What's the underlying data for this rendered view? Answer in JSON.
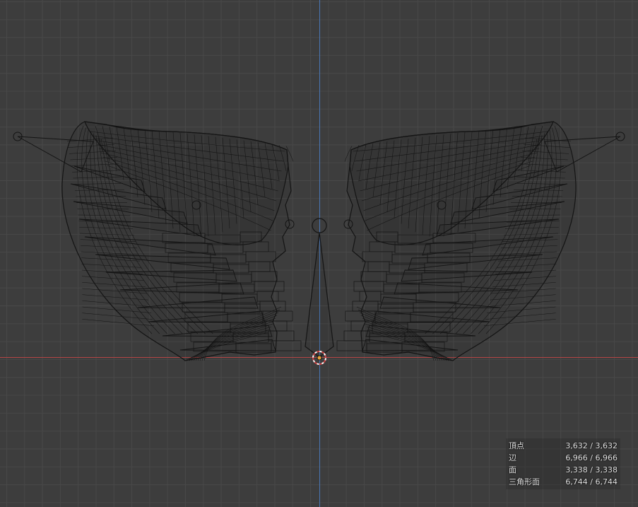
{
  "viewport": {
    "background_color": "#3d3d3d",
    "grid_color": "#484848",
    "axis_x_color": "#b54545",
    "axis_y_color": "#4a77b5",
    "wire_color": "#141414",
    "origin_color": "#e8a33a"
  },
  "stats": [
    {
      "label": "頂点",
      "value": "3,632 / 3,632"
    },
    {
      "label": "辺",
      "value": "6,966 / 6,966"
    },
    {
      "label": "面",
      "value": "3,338 / 3,338"
    },
    {
      "label": "三角形面",
      "value": "6,744 / 6,744"
    }
  ]
}
